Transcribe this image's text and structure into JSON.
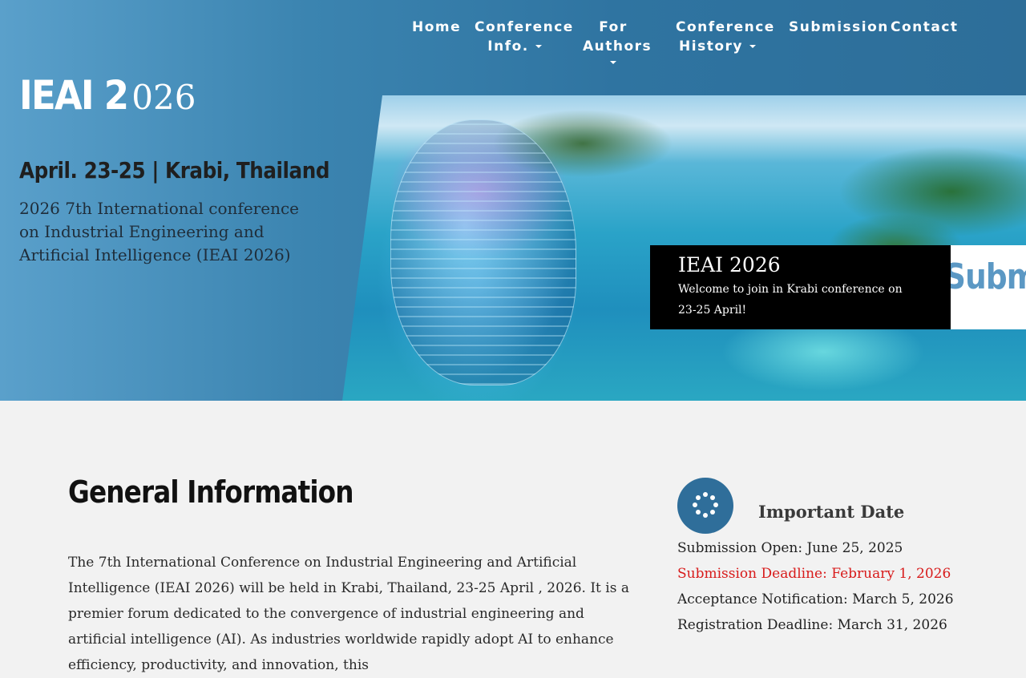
{
  "nav": {
    "home": "Home",
    "conference_info": [
      "Conference",
      "Info."
    ],
    "for_authors": [
      "For",
      "Authors"
    ],
    "conference_history": [
      "Conference",
      "History"
    ],
    "submission": "Submission",
    "contact": "Contact"
  },
  "hero": {
    "logo_big": "IEAI 2",
    "logo_small": "026",
    "date_location": "April. 23-25 | Krabi, Thailand",
    "conference_full": "2026 7th International conference on Industrial Engineering and Artificial Intelligence (IEAI 2026)",
    "caption_title": "IEAI 2026",
    "caption_text": "Welcome to join in Krabi conference on 23-25 April!",
    "submit_tab": "Submit"
  },
  "general": {
    "title": "General Information",
    "body": "The 7th International Conference on Industrial Engineering and Artificial Intelligence (IEAI 2026) will be held in Krabi, Thailand, 23-25 April , 2026. It is a premier forum dedicated to the convergence of industrial engineering and artificial intelligence (AI). As industries worldwide rapidly adopt AI to enhance efficiency, productivity, and innovation, this"
  },
  "important": {
    "icon": "spinner-dots-icon",
    "title": "Important Date",
    "dates": [
      {
        "text": "Submission Open: June 25, 2025",
        "highlight": false
      },
      {
        "text": "Submission Deadline: February 1, 2026",
        "highlight": true
      },
      {
        "text": "Acceptance Notification:  March 5, 2026",
        "highlight": false
      },
      {
        "text": "Registration Deadline: March 31, 2026",
        "highlight": false
      }
    ]
  },
  "colors": {
    "brand_blue": "#2f6e9a",
    "deadline_red": "#d81b1b"
  }
}
